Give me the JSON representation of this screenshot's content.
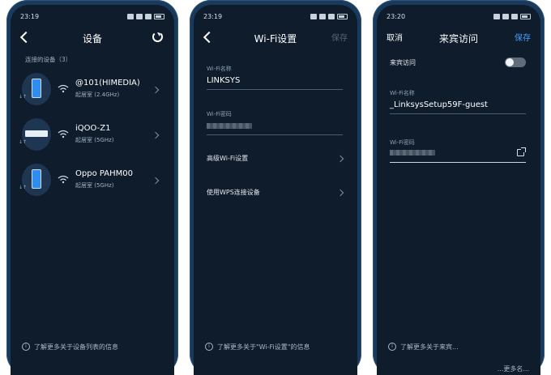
{
  "colors": {
    "screen_bg": "#0f1c2c",
    "accent": "#4a9eff",
    "disabled": "#55657a",
    "frame": "#1a3a5c"
  },
  "screen1": {
    "time": "23:19",
    "title": "设备",
    "section_label": "连接的设备（3）",
    "devices": [
      {
        "name": "@101(HIMEDIA)",
        "detail": "起居室 (2.4GHz)",
        "icon": "phone-icon"
      },
      {
        "name": "iQOO-Z1",
        "detail": "起居室 (5GHz)",
        "icon": "router-icon"
      },
      {
        "name": "Oppo PAHM00",
        "detail": "起居室 (5GHz)",
        "icon": "phone-icon"
      }
    ],
    "footer": "了解更多关于设备列表的信息"
  },
  "screen2": {
    "time": "23:19",
    "title": "Wi-Fi设置",
    "save_label": "保存",
    "wifi_name_label": "Wi-Fi名称",
    "wifi_name_value": "LINKSYS",
    "wifi_password_label": "Wi-Fi密码",
    "menu_items": [
      "高级Wi-Fi设置",
      "使用WPS连接设备"
    ],
    "footer": "了解更多关于\"Wi-Fi设置\"的信息"
  },
  "screen3": {
    "time": "23:20",
    "title": "来宾访问",
    "cancel_label": "取消",
    "save_label": "保存",
    "guest_access_label": "来宾访问",
    "wifi_name_label": "Wi-Fi名称",
    "wifi_name_value": "_LinksysSetup59F-guest",
    "wifi_password_label": "Wi-Fi密码",
    "footer": "了解更多关于来宾...",
    "watermark": "...更多名..."
  }
}
